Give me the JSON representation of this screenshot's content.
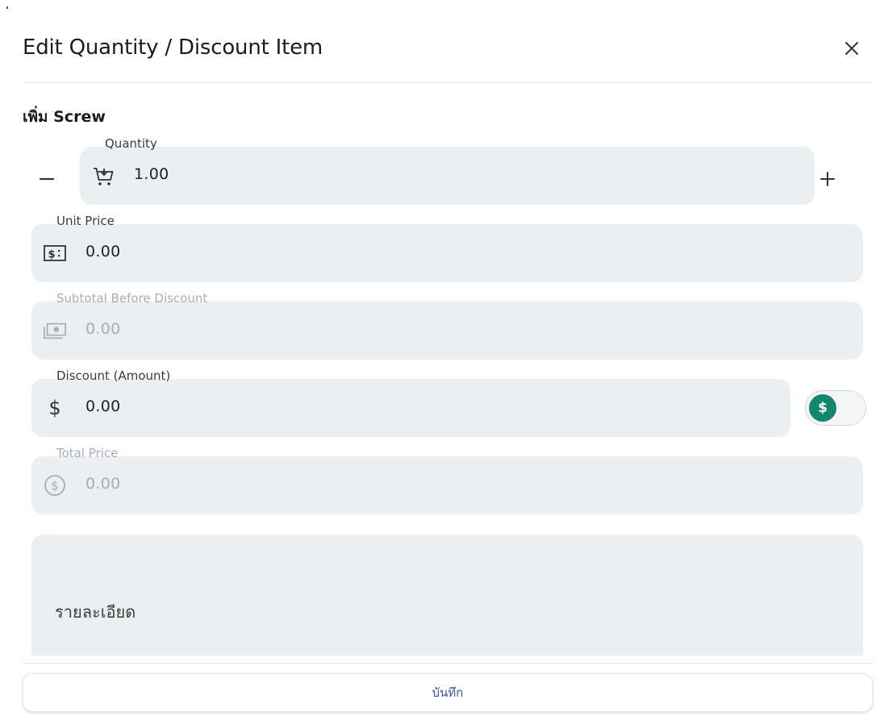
{
  "dialog": {
    "title": "Edit Quantity / Discount Item",
    "subtitle": "เพิ่ม  Screw"
  },
  "quantity": {
    "label": "Quantity",
    "value": "1.00"
  },
  "unit_price": {
    "label": "Unit Price",
    "value": "0.00"
  },
  "subtotal": {
    "label": "Subtotal Before Discount",
    "value": "0.00"
  },
  "discount": {
    "label": "Discount (Amount)",
    "value": "0.00",
    "currency_symbol": "$",
    "toggle_symbol": "$"
  },
  "total": {
    "label": "Total Price",
    "value": "0.00"
  },
  "notes": {
    "placeholder": "รายละเอียด"
  },
  "actions": {
    "save_label": "บันทึก"
  },
  "colors": {
    "field_bg": "#eceff2",
    "accent_green": "#13866f",
    "save_text": "#3f51b5"
  },
  "icons": {
    "close": "close-icon",
    "minus": "minus-icon",
    "plus": "plus-icon",
    "quantity": "cart-icon",
    "unit_price": "price-tag-icon",
    "subtotal": "banknote-icon",
    "discount": "dollar-icon",
    "total": "dollar-circle-icon"
  }
}
